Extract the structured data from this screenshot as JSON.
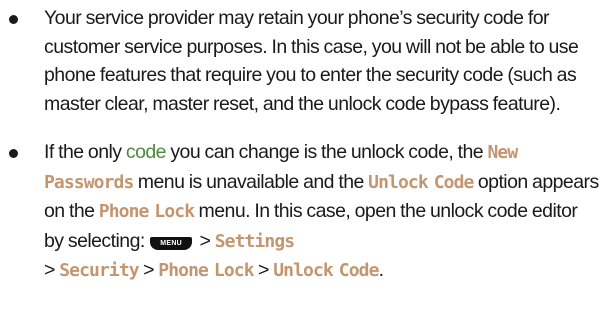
{
  "bullets": [
    {
      "text_1": "Your service provider may retain your phone’s security code for customer service purposes. In this case, you will not be able to use phone features that require you to enter the security code (such as master clear, master reset, and the unlock code bypass feature)."
    },
    {
      "text_1": "If the only ",
      "link_code": "code",
      "text_2": " you can change is the unlock code, the ",
      "menu_new_passwords": "New Passwords",
      "text_3": " menu is unavailable and the ",
      "menu_unlock_code": "Unlock Code",
      "text_4": " option appears on the ",
      "menu_phone_lock": "Phone Lock",
      "text_5": " menu. In this case, open the unlock code editor by selecting: ",
      "menu_key_label": "MENU",
      "path_sep_1": " > ",
      "path_settings": "Settings",
      "path_sep_2": " > ",
      "path_security": "Security",
      "path_sep_3": " > ",
      "path_phone_lock": "Phone Lock",
      "path_sep_4": " > ",
      "path_unlock_code": "Unlock Code",
      "text_end": "."
    }
  ],
  "colors": {
    "menu_term": "#c4966f",
    "link": "#4e8a3c",
    "text": "#1a1a1a"
  }
}
